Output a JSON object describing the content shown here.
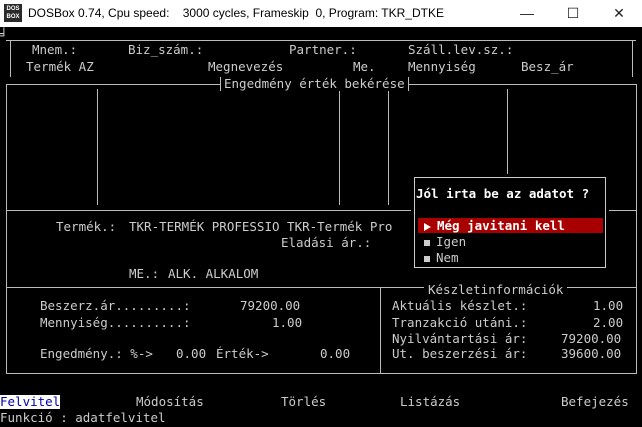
{
  "window": {
    "icon_text": "DOS BOX",
    "title": "DOSBox 0.74, Cpu speed:    3000 cycles, Frameskip  0, Program: TKR_DTKE",
    "minimize_icon": "minimize-icon",
    "maximize_icon": "maximize-icon",
    "close_icon": "close-icon"
  },
  "header": {
    "corner_mark": "╛",
    "mnem": "Mnem.:",
    "biz_szam": "Biz_szám.:",
    "partner": "Partner.:",
    "szall": "Száll.lev.sz.:"
  },
  "columns": {
    "termek_az": "Termék AZ",
    "megnevezes": "Megnevezés",
    "me": "Me.",
    "mennyiseg": "Mennyiség",
    "besz_ar": "Besz_ár"
  },
  "panel_title": "Engedmény érték bekérése",
  "product": {
    "termek_label": "Termék.:",
    "termek_value": "TKR-TERMÉK PROFESSIO TKR-Termék Pro",
    "eladasi_label": "Eladási ár.:",
    "me_label": "ME.:",
    "me_value": "ALK. ALKALOM"
  },
  "left_box": {
    "beszerz_label": "Beszerz.ár.........:",
    "beszerz_value": "79200.00",
    "mennyiseg_label": "Mennyiség..........:",
    "mennyiseg_value": "1.00",
    "engedmeny_label": "Engedmény.: %->",
    "engedmeny_value": "0.00",
    "ertek_label": "Érték->",
    "ertek_value": "0.00"
  },
  "stock": {
    "title": "Készletinformációk",
    "aktualis_label": "Aktuális készlet.:",
    "aktualis_value": "1.00",
    "tranzakcio_label": "Tranzakció utáni.:",
    "tranzakcio_value": "2.00",
    "nyilvantartasi_label": "Nyilvántartási ár:",
    "nyilvantartasi_value": "79200.00",
    "ut_beszerzesi_label": "Ut. beszerzési ár:",
    "ut_beszerzesi_value": "39600.00"
  },
  "dialog": {
    "question": "Jól irta be az adatot ?",
    "options": [
      "Még javitani kell",
      "Igen",
      "Nem"
    ],
    "selected_index": 0
  },
  "menu": {
    "items": [
      "Felvitel",
      "Módosítás",
      "Törlés",
      "Listázás",
      "Befejezés"
    ],
    "active_index": 0
  },
  "status": "Funkció : adatfelvitel",
  "colors": {
    "background": "#000000",
    "text": "#cccccc",
    "highlight": "#a80000",
    "menu_active_bg": "#ffffff",
    "menu_active_fg": "#0000aa"
  }
}
